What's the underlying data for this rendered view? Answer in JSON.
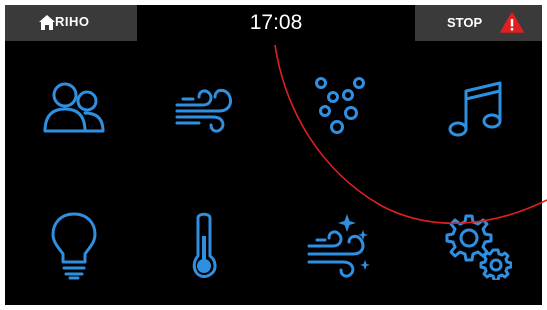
{
  "header": {
    "brand": "RIHO",
    "time": "17:08",
    "stop_label": "STOP"
  },
  "colors": {
    "icon": "#2f8fe0",
    "header_bg": "#3a3a3a",
    "screen_bg": "#000000",
    "warning": "#e02020",
    "annotation": "#e02020"
  },
  "tiles": [
    {
      "icon": "users-icon"
    },
    {
      "icon": "air-flow-icon"
    },
    {
      "icon": "bubbles-icon"
    },
    {
      "icon": "music-note-icon"
    },
    {
      "icon": "light-bulb-icon"
    },
    {
      "icon": "thermometer-icon"
    },
    {
      "icon": "air-sparkle-icon"
    },
    {
      "icon": "settings-gears-icon"
    }
  ]
}
